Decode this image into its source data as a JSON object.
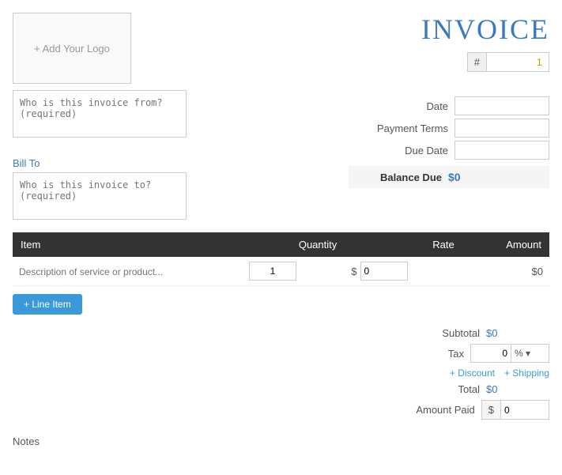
{
  "header": {
    "logo_label": "+ Add Your Logo",
    "invoice_title": "INVOICE",
    "invoice_hash": "#",
    "invoice_number": "1"
  },
  "from_section": {
    "placeholder": "Who is this invoice from? (required)"
  },
  "bill_to": {
    "label": "Bill To",
    "placeholder": "Who is this invoice to? (required)"
  },
  "right_fields": {
    "date_label": "Date",
    "payment_terms_label": "Payment Terms",
    "due_date_label": "Due Date",
    "balance_due_label": "Balance Due",
    "balance_due_value": "$0"
  },
  "table": {
    "col_item": "Item",
    "col_quantity": "Quantity",
    "col_rate": "Rate",
    "col_amount": "Amount",
    "row_placeholder": "Description of service or product...",
    "row_quantity": "1",
    "row_rate": "0",
    "row_amount": "$0"
  },
  "add_line_btn": "+ Line Item",
  "totals": {
    "subtotal_label": "Subtotal",
    "subtotal_value": "$0",
    "tax_label": "Tax",
    "tax_value": "0",
    "tax_percent": "%",
    "discount_label": "+ Discount",
    "shipping_label": "+ Shipping",
    "total_label": "Total",
    "total_value": "$0",
    "amount_paid_label": "Amount Paid",
    "amount_paid_dollar": "$",
    "amount_paid_value": "0"
  },
  "notes": {
    "label": "Notes"
  }
}
